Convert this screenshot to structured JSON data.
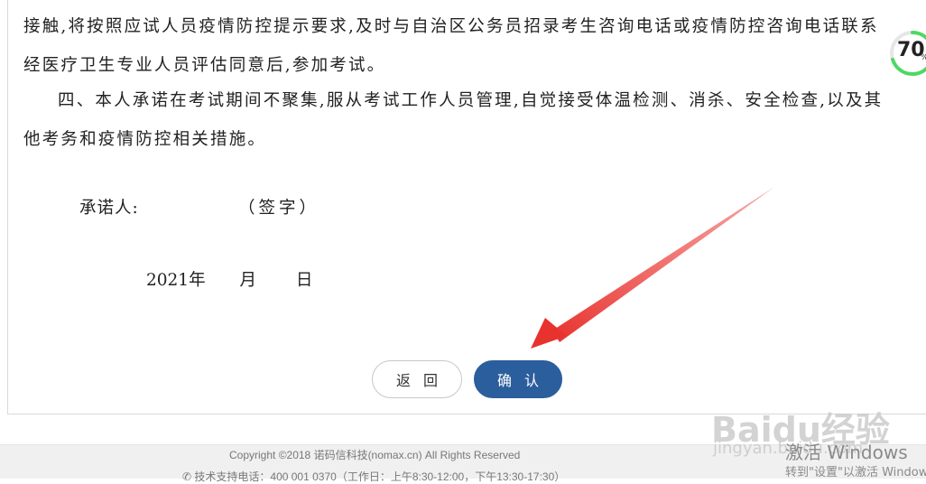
{
  "document": {
    "lines": [
      "接触,将按照应试人员疫情防控提示要求,及时与自治区公务员招录考生咨询电话或疫情防控咨询电话联系",
      "经医疗卫生专业人员评估同意后,参加考试。",
      "四、本人承诺在考试期间不聚集,服从考试工作人员管理,自觉接受体温检测、消杀、安全检查,以及其",
      "他考务和疫情防控相关措施。"
    ],
    "signer_label": "承诺人:",
    "signature_label": "（签字）",
    "date_year": "2021年",
    "date_month": "月",
    "date_day": "日"
  },
  "actions": {
    "back_label": "返回",
    "confirm_label": "确认"
  },
  "footer": {
    "copyright": "Copyright ©2018 诺码信科技(nomax.cn) All Rights Reserved",
    "support": "技术支持电话：400 001 0370（工作日：上午8:30-12:00，下午13:30-17:30）"
  },
  "progress_widget": {
    "value": "70",
    "unit": "%",
    "ring_color": "#4cd964"
  },
  "overlay": {
    "watermark": "Baidu经验",
    "watermark_sub": "jingyan.baidu.com",
    "activate_title": "激活 Windows",
    "activate_sub": "转到\"设置\"以激活 Windows。"
  },
  "colors": {
    "confirm_button": "#2b5e9c",
    "arrow": "#e8322e"
  }
}
